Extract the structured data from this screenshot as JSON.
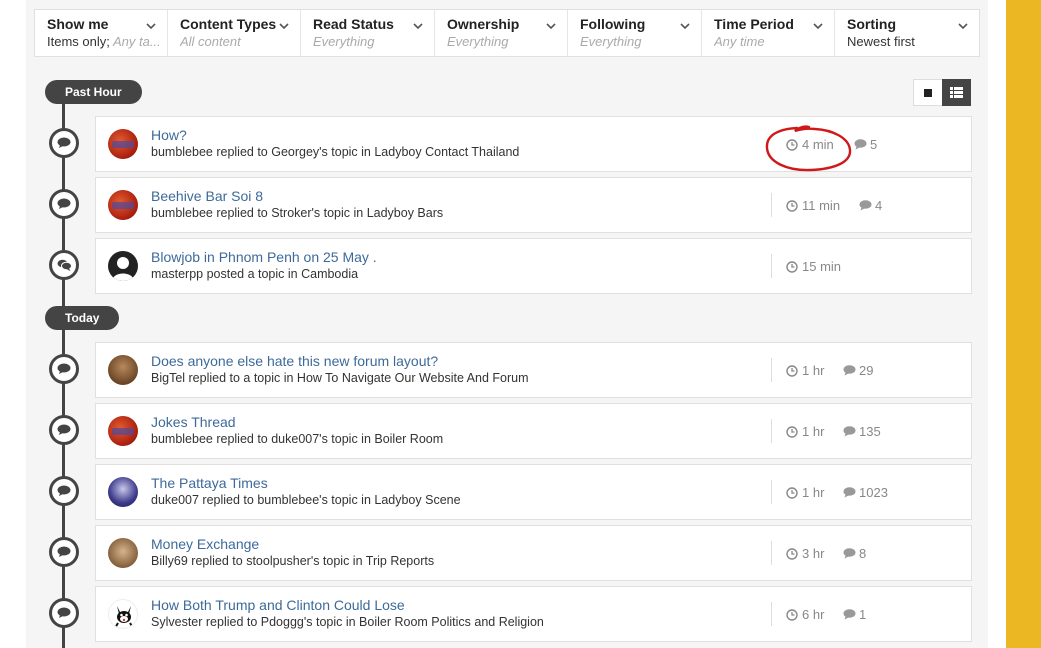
{
  "filters": [
    {
      "label": "Show me",
      "prefix": "Items only;",
      "value": " Any ta..."
    },
    {
      "label": "Content Types",
      "prefix": "",
      "value": "All content"
    },
    {
      "label": "Read Status",
      "prefix": "",
      "value": "Everything"
    },
    {
      "label": "Ownership",
      "prefix": "",
      "value": "Everything"
    },
    {
      "label": "Following",
      "prefix": "",
      "value": "Everything"
    },
    {
      "label": "Time Period",
      "prefix": "",
      "value": "Any time"
    },
    {
      "label": "Sorting",
      "prefix": "Newest first",
      "value": ""
    }
  ],
  "sections": [
    {
      "label": "Past Hour"
    },
    {
      "label": "Today"
    }
  ],
  "items": [
    {
      "title": "How?",
      "subtitle": "bumblebee replied to Georgey's topic in Ladyboy Contact Thailand",
      "time": "4 min",
      "replies": "5",
      "avatar": "red-logo"
    },
    {
      "title": "Beehive Bar Soi 8",
      "subtitle": "bumblebee replied to Stroker's topic in Ladyboy Bars",
      "time": "11 min",
      "replies": "4",
      "avatar": "red-logo"
    },
    {
      "title": "Blowjob in Phnom Penh on 25 May .",
      "subtitle": "masterpp posted a topic in Cambodia",
      "time": "15 min",
      "replies": "",
      "avatar": "default-user"
    },
    {
      "title": "Does anyone else hate this new forum layout?",
      "subtitle": "BigTel replied to a topic in How To Navigate Our Website And Forum",
      "time": "1 hr",
      "replies": "29",
      "avatar": "photo-brown"
    },
    {
      "title": "Jokes Thread",
      "subtitle": "bumblebee replied to duke007's topic in Boiler Room",
      "time": "1 hr",
      "replies": "135",
      "avatar": "red-logo"
    },
    {
      "title": "The Pattaya Times",
      "subtitle": "duke007 replied to bumblebee's topic in Ladyboy Scene",
      "time": "1 hr",
      "replies": "1023",
      "avatar": "photo-purple"
    },
    {
      "title": "Money Exchange",
      "subtitle": "Billy69 replied to stoolpusher's topic in Trip Reports",
      "time": "3 hr",
      "replies": "8",
      "avatar": "photo-tan"
    },
    {
      "title": "How Both Trump and Clinton Could Lose",
      "subtitle": "Sylvester replied to Pdoggg's topic in Boiler Room Politics and Religion",
      "time": "6 hr",
      "replies": "1",
      "avatar": "cartoon-cat"
    }
  ],
  "colors": {
    "accent_link": "#3d6a9a",
    "timeline": "#444444",
    "page_side": "#ebb824",
    "annotation": "#d01818"
  }
}
